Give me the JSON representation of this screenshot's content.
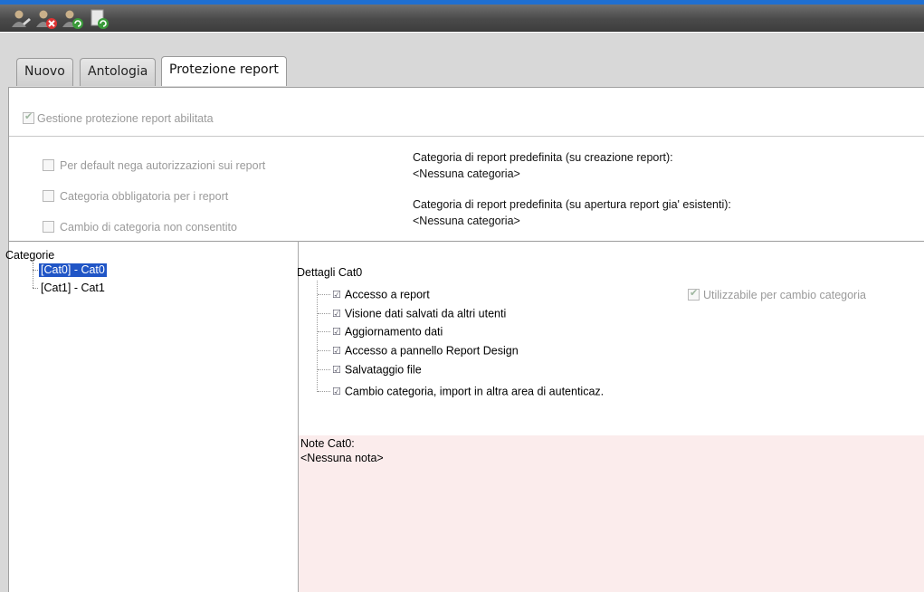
{
  "toolbar": {
    "buttons": [
      {
        "icon": "user-edit-icon"
      },
      {
        "icon": "user-delete-icon"
      },
      {
        "icon": "user-refresh-icon"
      },
      {
        "icon": "document-refresh-icon"
      }
    ]
  },
  "tabs": [
    {
      "label": "Nuovo"
    },
    {
      "label": "Antologia"
    },
    {
      "label": "Protezione report"
    }
  ],
  "protection": {
    "enabled_label": "Gestione protezione report abilitata",
    "enabled": true,
    "options": [
      {
        "label": "Per default nega autorizzazioni sui report",
        "checked": false
      },
      {
        "label": "Categoria obbligatoria per i report",
        "checked": false
      },
      {
        "label": "Cambio di categoria non consentito",
        "checked": false
      }
    ],
    "default_category_create_label": "Categoria di report predefinita (su creazione report):",
    "default_category_create_value": "<Nessuna categoria>",
    "default_category_open_label": "Categoria di report predefinita (su apertura report gia' esistenti):",
    "default_category_open_value": "<Nessuna categoria>"
  },
  "categories": {
    "root_label": "Categorie",
    "items": [
      {
        "label": "[Cat0] - Cat0",
        "selected": true
      },
      {
        "label": "[Cat1] - Cat1",
        "selected": false
      }
    ]
  },
  "details": {
    "title": "Dettagli Cat0",
    "permissions": [
      {
        "label": "Accesso a report",
        "checked": true
      },
      {
        "label": "Visione dati salvati da altri utenti",
        "checked": true
      },
      {
        "label": "Aggiornamento dati",
        "checked": true
      },
      {
        "label": "Accesso a pannello Report Design",
        "checked": true
      },
      {
        "label": "Salvataggio file",
        "checked": true
      },
      {
        "label": "Cambio categoria, import in altra area di autenticaz.",
        "checked": true
      }
    ],
    "usable_label": "Utilizzabile per cambio categoria",
    "usable": true
  },
  "notes": {
    "title": "Note Cat0:",
    "value": "<Nessuna nota>"
  },
  "colors": {
    "selection": "#2055c6",
    "notes_bg": "#fbecec",
    "title_strip": "#1f6fd1"
  }
}
